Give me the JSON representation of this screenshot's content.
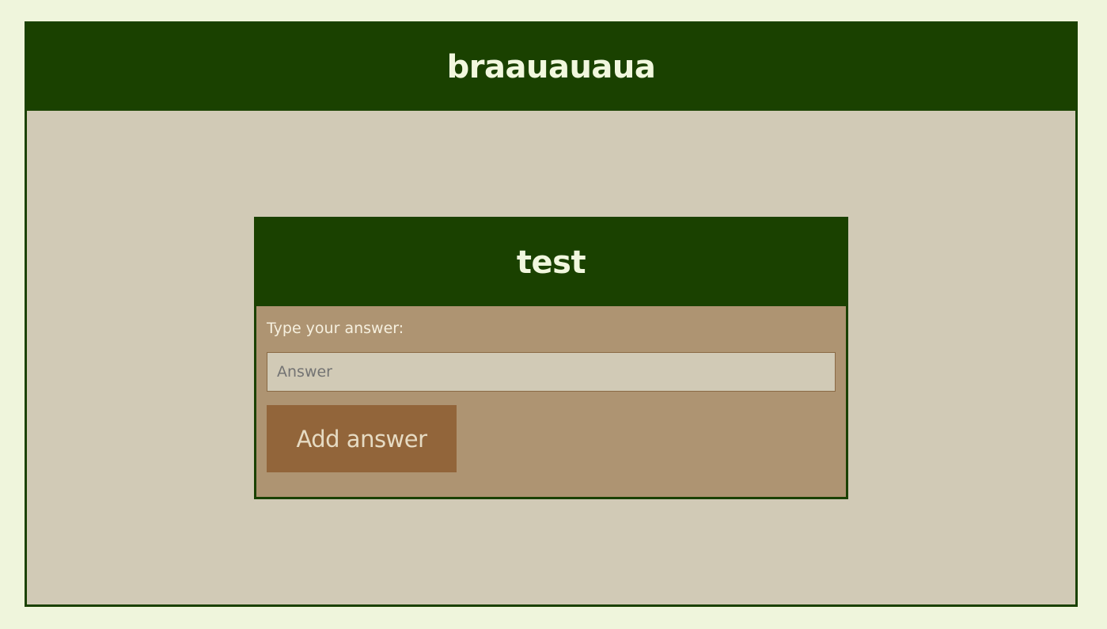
{
  "header": {
    "title": "braauauaua"
  },
  "question_card": {
    "title": "test",
    "answer_label": "Type your answer:",
    "answer_input": {
      "value": "",
      "placeholder": "Answer"
    },
    "add_button_label": "Add answer"
  },
  "colors": {
    "page_background": "#eff5dc",
    "header_green": "#1a4100",
    "content_background": "#d1cab6",
    "card_background": "#ae9472",
    "button_brown": "#92653a"
  }
}
